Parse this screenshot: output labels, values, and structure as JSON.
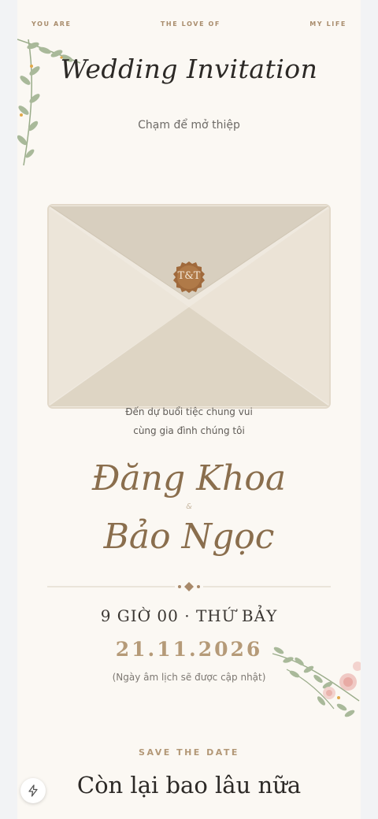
{
  "header": {
    "left": "YOU ARE",
    "center": "THE LOVE OF",
    "right": "MY LIFE"
  },
  "title": "Wedding Invitation",
  "tap_hint": "Chạm để mở thiệp",
  "envelope": {
    "seal_text": "T&T",
    "invite_line1": "Đến dự buổi tiệc chung vui",
    "invite_line2": "cùng gia đình chúng tôi"
  },
  "couple": {
    "groom": "Đăng Khoa",
    "ampersand": "&",
    "bride": "Bảo Ngọc"
  },
  "event": {
    "time": "9 GIỜ 00 · THỨ BẢY",
    "date": "21.11.2026",
    "lunar_note": "(Ngày âm lịch sẽ được cập nhật)"
  },
  "save_the_date": {
    "label": "SAVE THE DATE",
    "heading": "Còn lại bao lâu nữa"
  },
  "icons": {
    "fab": "lightning-icon",
    "decor_top": "vine-leaves-decoration",
    "decor_bottom": "rose-branch-decoration"
  },
  "colors": {
    "accent_brown": "#8a6e4d",
    "gold": "#b59a78",
    "seal": "#a06a3c",
    "paper": "#fbf8f3"
  }
}
